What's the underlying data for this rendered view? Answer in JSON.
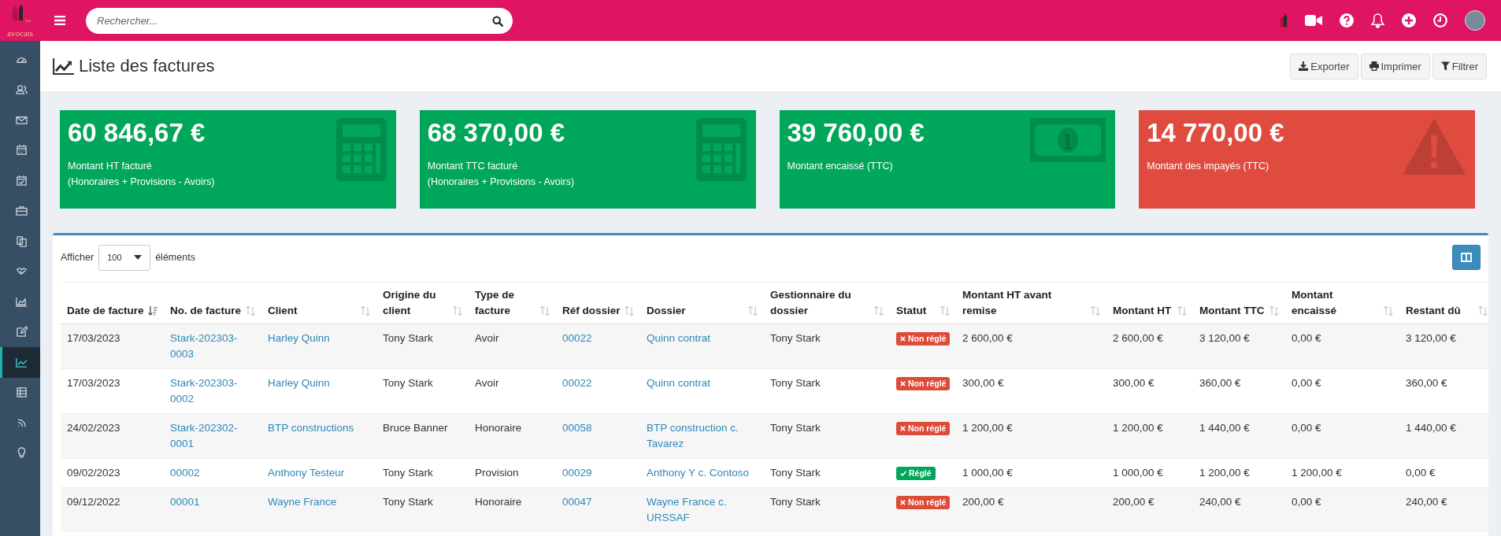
{
  "topbar": {
    "logo": {
      "small": "les",
      "name": "avocats"
    },
    "search": {
      "placeholder": "Rechercher..."
    }
  },
  "sidebar": {
    "items": [
      {
        "selected": false
      },
      {
        "selected": false
      },
      {
        "selected": false
      },
      {
        "selected": false
      },
      {
        "selected": false
      },
      {
        "selected": false
      },
      {
        "selected": false
      },
      {
        "selected": false
      },
      {
        "selected": false
      },
      {
        "selected": false
      },
      {
        "selected": true
      },
      {
        "selected": false
      },
      {
        "selected": false
      },
      {
        "selected": false
      }
    ]
  },
  "page": {
    "title": "Liste des factures",
    "actions": [
      "Exporter",
      "Imprimer",
      "Filtrer"
    ]
  },
  "stats": [
    {
      "amount": "60 846,67 €",
      "label": "Montant HT facturé",
      "sublabel": "(Honoraires + Provisions - Avoirs)",
      "kind": "calculator",
      "alert": false
    },
    {
      "amount": "68 370,00 €",
      "label": "Montant TTC facturé",
      "sublabel": "(Honoraires + Provisions - Avoirs)",
      "kind": "calculator",
      "alert": false
    },
    {
      "amount": "39 760,00 €",
      "label": "Montant encaissé (TTC)",
      "kind": "money",
      "alert": false
    },
    {
      "amount": "14 770,00 €",
      "label": "Montant des impayés (TTC)",
      "kind": "warning",
      "alert": true
    }
  ],
  "table": {
    "length_label": "Afficher",
    "length_value": "100",
    "length_suffix": "éléments",
    "columns": [
      {
        "label": "Date de facture",
        "kind": "text",
        "sorted": true
      },
      {
        "label": "No. de facture",
        "kind": "link",
        "sorted": false
      },
      {
        "label": "Client",
        "kind": "link",
        "sorted": false
      },
      {
        "label": "Origine du client",
        "kind": "text",
        "sorted": false
      },
      {
        "label": "Type de facture",
        "kind": "text",
        "sorted": false
      },
      {
        "label": "Réf dossier",
        "kind": "link",
        "sorted": false
      },
      {
        "label": "Dossier",
        "kind": "link",
        "sorted": false
      },
      {
        "label": "Gestionnaire du dossier",
        "kind": "text",
        "sorted": false
      },
      {
        "label": "Statut",
        "kind": "status",
        "sorted": false
      },
      {
        "label": "Montant HT avant remise",
        "kind": "text",
        "sorted": false
      },
      {
        "label": "Montant HT",
        "kind": "text",
        "sorted": false
      },
      {
        "label": "Montant TTC",
        "kind": "text",
        "sorted": false
      },
      {
        "label": "Montant encaissé",
        "kind": "text",
        "sorted": false
      },
      {
        "label": "Restant dû",
        "kind": "text",
        "sorted": false
      }
    ],
    "rows": [
      {
        "paid": false,
        "cells": [
          "17/03/2023",
          "Stark-202303-0003",
          "Harley Quinn",
          "Tony Stark",
          "Avoir",
          "00022",
          "Quinn contrat",
          "Tony Stark",
          "Non réglé",
          "2 600,00 €",
          "2 600,00 €",
          "3 120,00 €",
          "0,00 €",
          "3 120,00 €"
        ]
      },
      {
        "paid": false,
        "cells": [
          "17/03/2023",
          "Stark-202303-0002",
          "Harley Quinn",
          "Tony Stark",
          "Avoir",
          "00022",
          "Quinn contrat",
          "Tony Stark",
          "Non réglé",
          "300,00 €",
          "300,00 €",
          "360,00 €",
          "0,00 €",
          "360,00 €"
        ]
      },
      {
        "paid": false,
        "cells": [
          "24/02/2023",
          "Stark-202302-0001",
          "BTP constructions",
          "Bruce Banner",
          "Honoraire",
          "00058",
          "BTP construction c. Tavarez",
          "Tony Stark",
          "Non réglé",
          "1 200,00 €",
          "1 200,00 €",
          "1 440,00 €",
          "0,00 €",
          "1 440,00 €"
        ]
      },
      {
        "paid": true,
        "cells": [
          "09/02/2023",
          "00002",
          "Anthony Testeur",
          "Tony Stark",
          "Provision",
          "00029",
          "Anthony Y c. Contoso",
          "Tony Stark",
          "Réglé",
          "1 000,00 €",
          "1 000,00 €",
          "1 200,00 €",
          "1 200,00 €",
          "0,00 €"
        ]
      },
      {
        "paid": false,
        "cells": [
          "09/12/2022",
          "00001",
          "Wayne France",
          "Tony Stark",
          "Honoraire",
          "00047",
          "Wayne France c. URSSAF",
          "Tony Stark",
          "Non réglé",
          "200,00 €",
          "200,00 €",
          "240,00 €",
          "0,00 €",
          "240,00 €"
        ]
      }
    ]
  }
}
